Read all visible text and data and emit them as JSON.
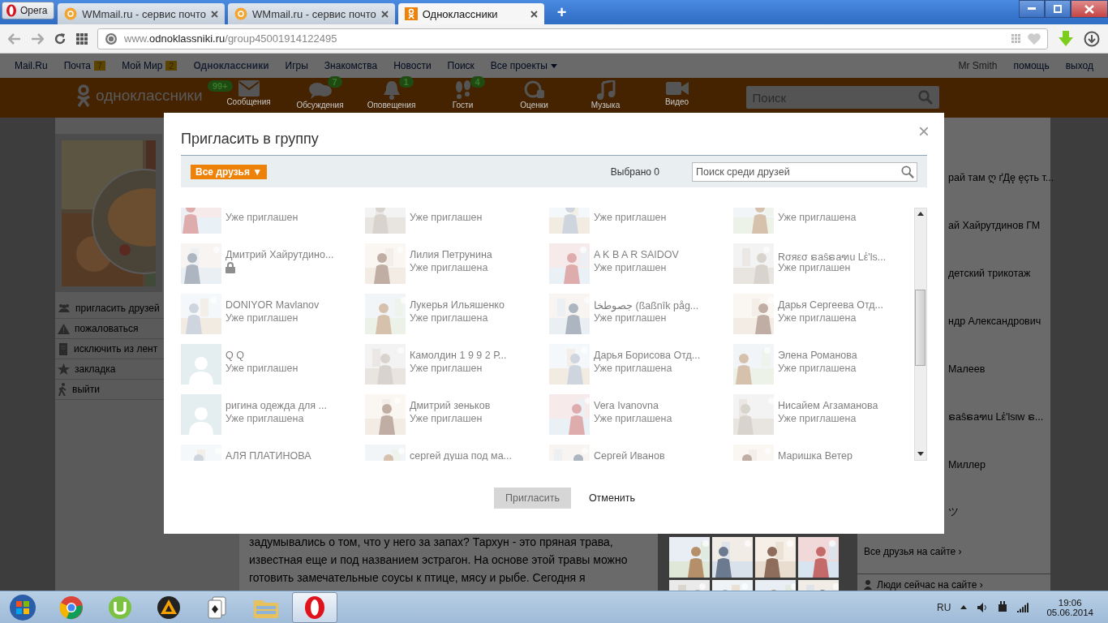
{
  "browser": {
    "opera_button": "Opera",
    "tabs": [
      {
        "title": "WMmail.ru - сервис почто",
        "kind": "wmmail",
        "selected": false
      },
      {
        "title": "WMmail.ru - сервис почто",
        "kind": "wmmail",
        "selected": false
      },
      {
        "title": "Одноклассники",
        "kind": "ok",
        "selected": true
      }
    ],
    "new_tab": "+",
    "url": {
      "prefix": "www.",
      "domain": "odnoklassniki.ru",
      "path": "/group45001914122495"
    }
  },
  "portal_bar": {
    "links": [
      {
        "label": "Mail.Ru",
        "selected": false
      },
      {
        "label": "Почта",
        "count": "7",
        "selected": false
      },
      {
        "label": "Мой Мир",
        "count": "2",
        "selected": false
      },
      {
        "label": "Одноклассники",
        "selected": true
      },
      {
        "label": "Игры",
        "selected": false
      },
      {
        "label": "Знакомства",
        "selected": false
      },
      {
        "label": "Новости",
        "selected": false
      },
      {
        "label": "Поиск",
        "selected": false
      }
    ],
    "all_projects": "Все проекты",
    "user": "Mr Smith",
    "help": "помощь",
    "logout": "выход"
  },
  "header": {
    "logo": "одноклассники",
    "logo_badge": "99+",
    "nav": [
      {
        "kind": "messages",
        "label": "Сообщения"
      },
      {
        "kind": "discussions",
        "label": "Обсуждения",
        "badge": "7"
      },
      {
        "kind": "alerts",
        "label": "Оповещения",
        "badge": "1"
      },
      {
        "kind": "guests",
        "label": "Гости",
        "badge": "4"
      },
      {
        "kind": "ratings",
        "label": "Оценки"
      },
      {
        "kind": "music",
        "label": "Музыка"
      },
      {
        "kind": "video",
        "label": "Видео"
      }
    ],
    "search_placeholder": "Поиск"
  },
  "group_menu": [
    {
      "kind": "invite",
      "label": "пригласить друзей"
    },
    {
      "kind": "complain",
      "label": "пожаловаться"
    },
    {
      "kind": "exclude",
      "label": "исключить из лент"
    },
    {
      "kind": "bookmark",
      "label": "закладка"
    },
    {
      "kind": "leave",
      "label": "выйти"
    }
  ],
  "article": {
    "text": "задумывались о том, что у него за запах? Тархун - это пряная трава, известная еще и под названием эстрагон. На основе этой травы можно готовить замечательные соусы к птице, мясу и рыбе. Сегодня я"
  },
  "friends_online": {
    "names": [
      "рай там ღ ґДę ęçть т...",
      "ай Хайрутдинов ГМ",
      "детский трикотаж",
      "ндр Александрович",
      "Малеев",
      "ຣaŝຣaฑu Lἐ'lѕιw ຣ...",
      "Миллер",
      "ツ"
    ],
    "all_link": "Все друзья на сайте ›",
    "people_link": "Люди сейчас на сайте ›"
  },
  "dialog": {
    "title": "Пригласить в группу",
    "close": "×",
    "filter": "Все друзья ▼",
    "selected_count": "Выбрано 0",
    "search_placeholder": "Поиск среди друзей",
    "friends": [
      {
        "kind": "picture",
        "status": "Уже приглашен",
        "locked": false
      },
      {
        "kind": "picture",
        "status": "Уже приглашен",
        "locked": false
      },
      {
        "kind": "picture",
        "status": "Уже приглашен",
        "locked": false
      },
      {
        "kind": "picture",
        "status": "Уже приглашена",
        "locked": false
      },
      {
        "kind": "picture",
        "name": "Дмитрий Хайрутдино...",
        "locked": true
      },
      {
        "kind": "picture",
        "name": "Лилия Петрунина",
        "status": "Уже приглашена",
        "locked": false
      },
      {
        "kind": "picture",
        "name": "A K B A R SAIDOV",
        "status": "Уже приглашен",
        "locked": false
      },
      {
        "kind": "picture",
        "name": "Rσяεσ ຣaŝຣaฑu Lἐ'lѕ...",
        "status": "Уже приглашен",
        "locked": false
      },
      {
        "kind": "picture",
        "name": "DONIYOR Mavlanov",
        "status": "Уже приглашен",
        "locked": false
      },
      {
        "kind": "picture",
        "name": "Лукерья Ильяшенко",
        "status": "Уже приглашена",
        "locked": false
      },
      {
        "kind": "picture",
        "name": "جصوطخا (ßaßnîk påg...",
        "status": "Уже приглашен",
        "locked": false
      },
      {
        "kind": "picture",
        "name": "Дарья Сергеева Отд...",
        "status": "Уже приглашена",
        "locked": false
      },
      {
        "kind": "placeholder",
        "name": "Q Q",
        "status": "Уже приглашен",
        "locked": false
      },
      {
        "kind": "picture",
        "name": "Камолдин 1 9 9 2 Р...",
        "status": "Уже приглашен",
        "locked": false
      },
      {
        "kind": "picture",
        "name": "Дарья Борисова Отд...",
        "status": "Уже приглашена",
        "locked": false
      },
      {
        "kind": "picture",
        "name": "Элена Романова",
        "status": "Уже приглашена",
        "locked": false
      },
      {
        "kind": "placeholder",
        "name": "ригина одежда для ...",
        "status": "Уже приглашена",
        "locked": false
      },
      {
        "kind": "picture",
        "name": "Дмитрий зеньков",
        "status": "Уже приглашен",
        "locked": false
      },
      {
        "kind": "picture",
        "name": "Vera Ivanovna",
        "status": "Уже приглашена",
        "locked": false
      },
      {
        "kind": "picture",
        "name": "Нисайем Агзаманова",
        "status": "Уже приглашена",
        "locked": false
      },
      {
        "kind": "picture",
        "name": "АЛЯ ПЛАТИНОВА",
        "locked": false
      },
      {
        "kind": "picture",
        "name": "сергей душа под ма...",
        "locked": false
      },
      {
        "kind": "picture",
        "name": "Сергей Иванов",
        "locked": false
      },
      {
        "kind": "picture",
        "name": "Маришка Ветер",
        "locked": false
      }
    ],
    "invite_button": {
      "label": "Пригласить",
      "disabled": true
    },
    "cancel": "Отменить"
  },
  "taskbar": {
    "apps": [
      {
        "kind": "windows",
        "selected": false
      },
      {
        "kind": "chrome",
        "selected": false
      },
      {
        "kind": "utorrent",
        "selected": false
      },
      {
        "kind": "aimp",
        "selected": false
      },
      {
        "kind": "solitaire",
        "selected": false
      },
      {
        "kind": "explorer",
        "selected": false
      },
      {
        "kind": "opera",
        "selected": true
      }
    ],
    "language": "RU",
    "time": "19:06",
    "date": "05.06.2014"
  }
}
